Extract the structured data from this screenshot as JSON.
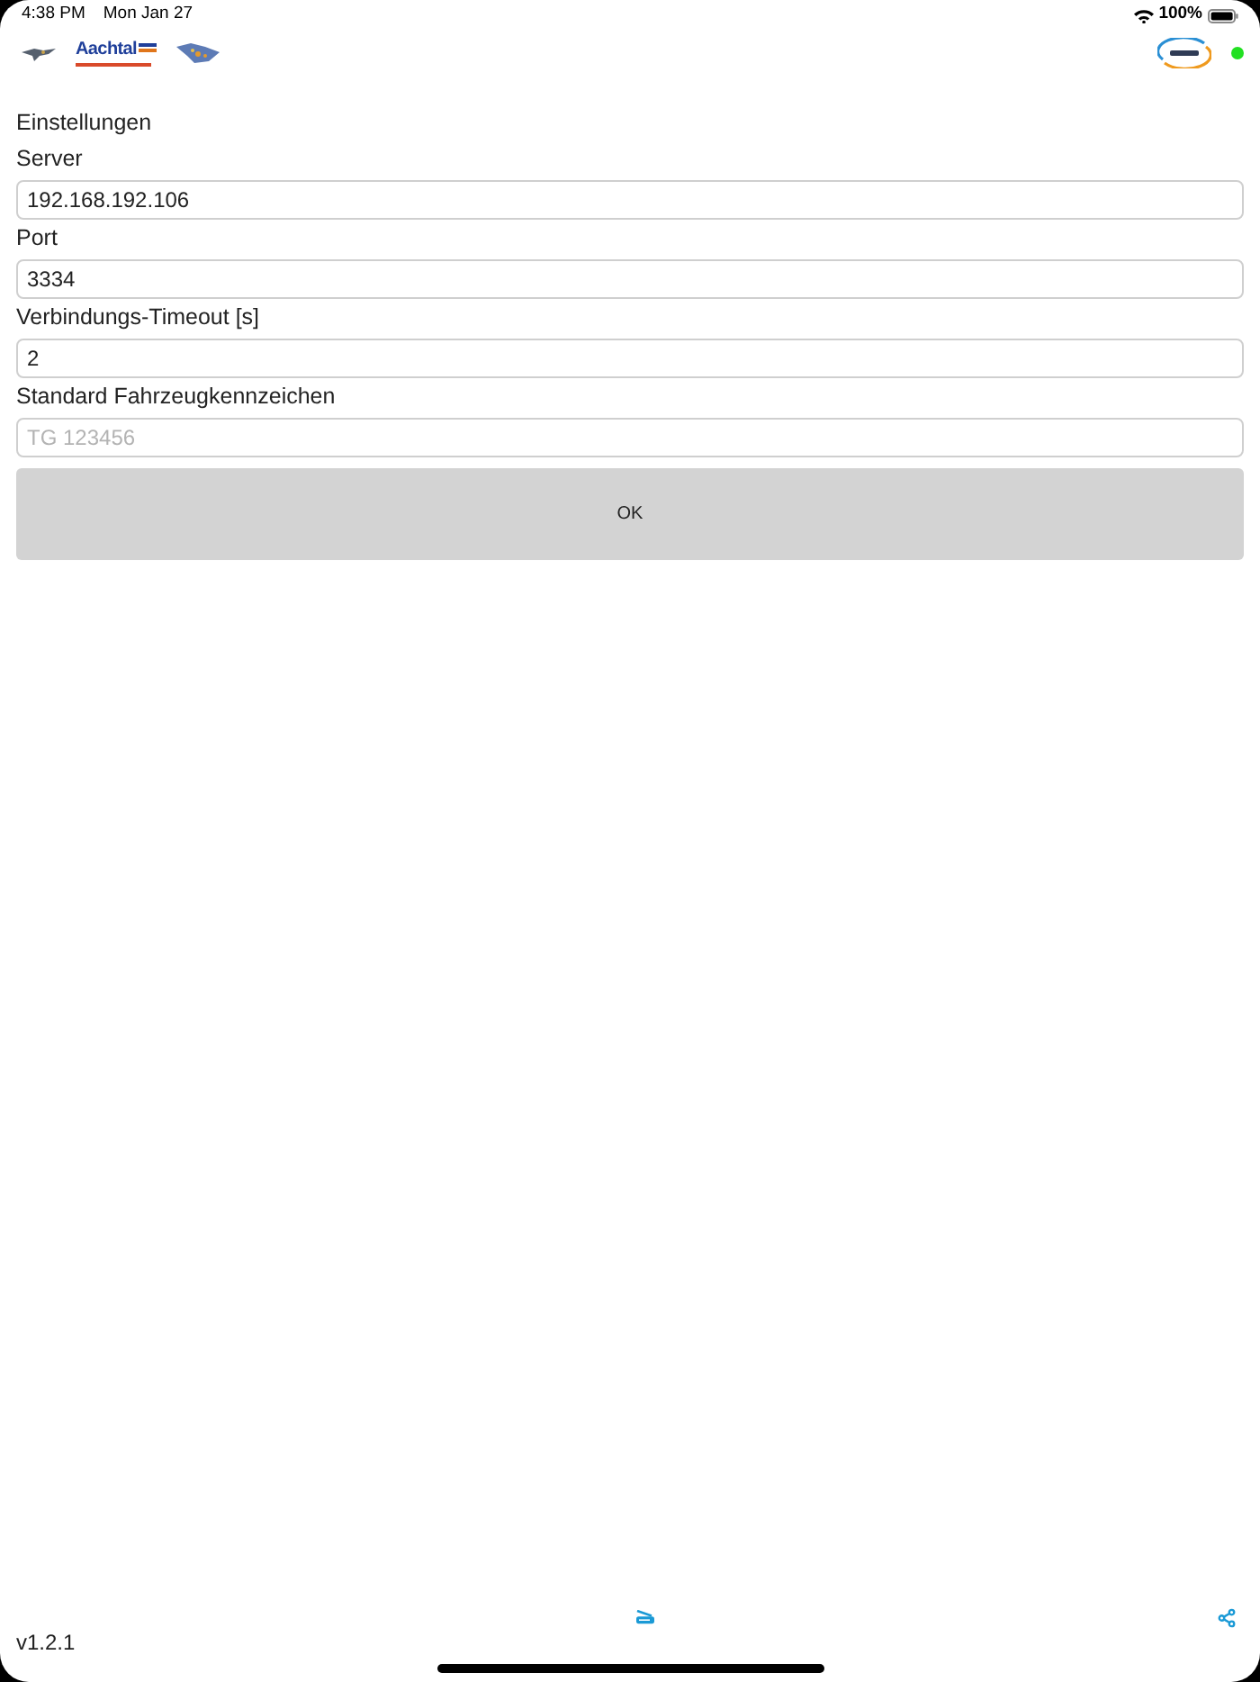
{
  "status_bar": {
    "time": "4:38 PM",
    "date": "Mon Jan 27",
    "battery": "100%"
  },
  "header": {
    "logo_text": "Aachtal",
    "connected": true
  },
  "title": "Einstellungen",
  "fields": [
    {
      "label": "Server",
      "value": "192.168.192.106"
    },
    {
      "label": "Port",
      "value": "3334"
    },
    {
      "label": "Verbindungs-Timeout [s]",
      "value": "2"
    },
    {
      "label": "Standard Fahrzeugkennzeichen",
      "placeholder": "TG 123456"
    }
  ],
  "ok_button": "OK",
  "footer": {
    "version": "v1.2.1"
  }
}
